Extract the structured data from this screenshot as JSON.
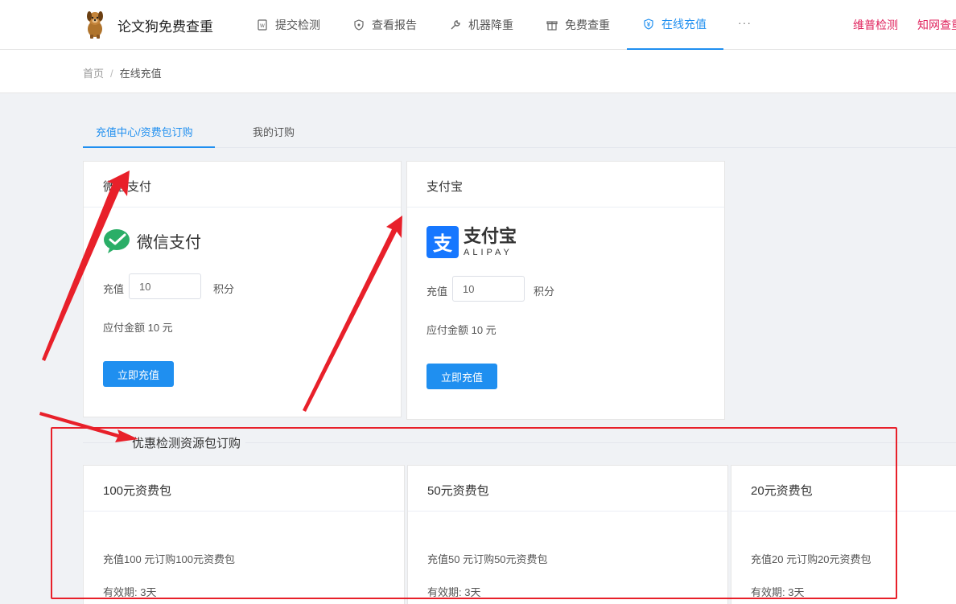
{
  "header": {
    "brand": "论文狗免费查重",
    "nav": [
      {
        "label": "提交检测",
        "icon": "document-icon"
      },
      {
        "label": "查看报告",
        "icon": "shield-icon"
      },
      {
        "label": "机器降重",
        "icon": "wrench-icon"
      },
      {
        "label": "免费查重",
        "icon": "gift-icon"
      },
      {
        "label": "在线充值",
        "icon": "yen-shield-icon",
        "active": true
      }
    ],
    "more": "···",
    "right_links": [
      "维普检测",
      "知网查重"
    ]
  },
  "breadcrumb": {
    "home": "首页",
    "separator": "/",
    "current": "在线充值"
  },
  "tabs": [
    {
      "label": "充值中心/资费包订购",
      "active": true
    },
    {
      "label": "我的订购",
      "active": false
    }
  ],
  "wechat": {
    "title": "微信支付",
    "logo_text": "微信支付",
    "recharge_label": "充值",
    "value": "10",
    "unit": "积分",
    "amount": "应付金额 10 元",
    "button": "立即充值"
  },
  "alipay": {
    "title": "支付宝",
    "logo_cn": "支付宝",
    "logo_en": "ALIPAY",
    "recharge_label": "充值",
    "value": "10",
    "unit": "积分",
    "amount": "应付金额 10 元",
    "button": "立即充值"
  },
  "section_title": "优惠检测资源包订购",
  "packages": [
    {
      "title": "100元资费包",
      "desc": "充值100 元订购100元资费包",
      "valid": "有效期: 3天"
    },
    {
      "title": "50元资费包",
      "desc": "充值50 元订购50元资费包",
      "valid": "有效期: 3天"
    },
    {
      "title": "20元资费包",
      "desc": "充值20 元订购20元资费包",
      "valid": "有效期: 3天"
    }
  ],
  "colors": {
    "accent": "#1f8ff0",
    "link_red": "#e0245e",
    "annotation_red": "#e8202a",
    "wechat_green": "#2aae67",
    "alipay_blue": "#1677ff"
  }
}
